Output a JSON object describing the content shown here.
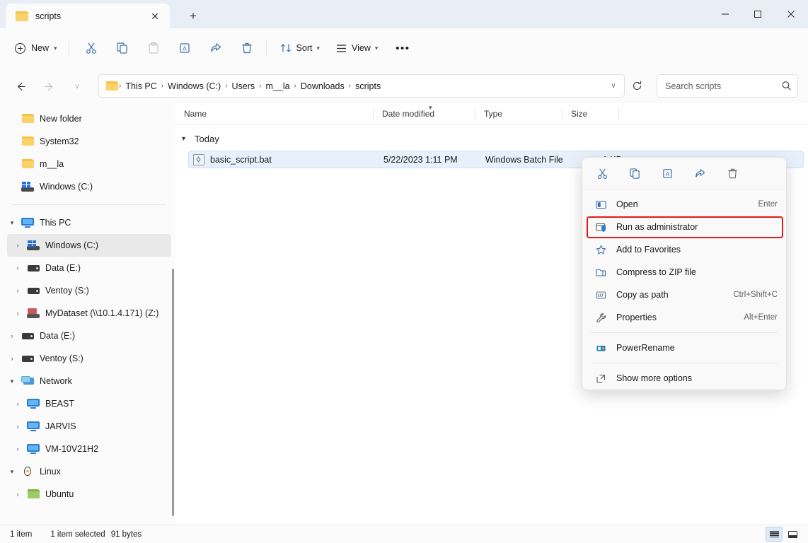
{
  "window": {
    "tab_title": "scripts",
    "controls": {
      "minimize": "—",
      "maximize": "☐",
      "close": "✕"
    },
    "new_tab_label": "+",
    "tab_close_label": "✕"
  },
  "toolbar": {
    "new_label": "New",
    "sort_label": "Sort",
    "view_label": "View",
    "more_label": "•••",
    "buttons": [
      "cut-icon",
      "copy-icon",
      "paste-icon",
      "rename-icon",
      "share-icon",
      "delete-icon"
    ]
  },
  "address": {
    "back": "←",
    "forward": "→",
    "recent": "∨",
    "up": "↑",
    "crumbs": [
      "This PC",
      "Windows (C:)",
      "Users",
      "m__la",
      "Downloads",
      "scripts"
    ],
    "separator": "›",
    "dropdown": "∨",
    "refresh": "⟳"
  },
  "search": {
    "placeholder": "Search scripts",
    "value": "",
    "icon": "search-icon"
  },
  "sidebar": {
    "quick_items": [
      {
        "label": "New folder",
        "icon": "folder-icon",
        "caret": "",
        "indent": 1
      },
      {
        "label": "System32",
        "icon": "folder-icon",
        "caret": "",
        "indent": 1
      },
      {
        "label": "m__la",
        "icon": "folder-icon",
        "caret": "",
        "indent": 1
      },
      {
        "label": "Windows (C:)",
        "icon": "windows-drive-icon",
        "caret": "",
        "indent": 1
      }
    ],
    "tree_items": [
      {
        "label": "This PC",
        "icon": "pc-icon",
        "caret": "⌄",
        "indent": 0,
        "selected": false
      },
      {
        "label": "Windows (C:)",
        "icon": "windows-drive-icon",
        "caret": "›",
        "indent": 1,
        "selected": true
      },
      {
        "label": "Data (E:)",
        "icon": "drive-icon",
        "caret": "›",
        "indent": 1,
        "selected": false
      },
      {
        "label": "Ventoy (S:)",
        "icon": "drive-icon",
        "caret": "›",
        "indent": 1,
        "selected": false
      },
      {
        "label": "MyDataset (\\\\10.1.4.171) (Z:)",
        "icon": "network-drive-icon",
        "caret": "›",
        "indent": 1,
        "selected": false
      },
      {
        "label": "Data (E:)",
        "icon": "drive-icon",
        "caret": "›",
        "indent": 0,
        "selected": false
      },
      {
        "label": "Ventoy (S:)",
        "icon": "drive-icon",
        "caret": "›",
        "indent": 0,
        "selected": false
      },
      {
        "label": "Network",
        "icon": "network-icon",
        "caret": "⌄",
        "indent": 0,
        "selected": false
      },
      {
        "label": "BEAST",
        "icon": "pc-icon",
        "caret": "›",
        "indent": 1,
        "selected": false
      },
      {
        "label": "JARVIS",
        "icon": "pc-icon",
        "caret": "›",
        "indent": 1,
        "selected": false
      },
      {
        "label": "VM-10V21H2",
        "icon": "pc-icon",
        "caret": "›",
        "indent": 1,
        "selected": false
      },
      {
        "label": "Linux",
        "icon": "linux-icon",
        "caret": "⌄",
        "indent": 0,
        "selected": false
      },
      {
        "label": "Ubuntu",
        "icon": "folder-green-icon",
        "caret": "›",
        "indent": 1,
        "selected": false
      }
    ]
  },
  "columns": [
    {
      "label": "Name",
      "key": "name"
    },
    {
      "label": "Date modified",
      "key": "date"
    },
    {
      "label": "Type",
      "key": "type"
    },
    {
      "label": "Size",
      "key": "size"
    }
  ],
  "group": {
    "caret": "⌄",
    "label": "Today"
  },
  "files": [
    {
      "name": "basic_script.bat",
      "date": "5/22/2023 1:11 PM",
      "type": "Windows Batch File",
      "size": "1 KB",
      "icon": "bat-file-icon",
      "selected": true
    }
  ],
  "context_menu": {
    "icon_row": [
      {
        "name": "cut-icon",
        "glyph": "✂"
      },
      {
        "name": "copy-icon",
        "glyph": "⧉"
      },
      {
        "name": "rename-icon",
        "glyph": "A"
      },
      {
        "name": "share-icon",
        "glyph": "↪"
      },
      {
        "name": "delete-icon",
        "glyph": "🗑"
      }
    ],
    "items": [
      {
        "label": "Open",
        "accel": "Enter",
        "icon": "open-icon",
        "highlighted": false,
        "sep_after": false
      },
      {
        "label": "Run as administrator",
        "accel": "",
        "icon": "shield-icon",
        "highlighted": true,
        "sep_after": false
      },
      {
        "label": "Add to Favorites",
        "accel": "",
        "icon": "star-icon",
        "highlighted": false,
        "sep_after": false
      },
      {
        "label": "Compress to ZIP file",
        "accel": "",
        "icon": "zip-icon",
        "highlighted": false,
        "sep_after": false
      },
      {
        "label": "Copy as path",
        "accel": "Ctrl+Shift+C",
        "icon": "copy-path-icon",
        "highlighted": false,
        "sep_after": false
      },
      {
        "label": "Properties",
        "accel": "Alt+Enter",
        "icon": "wrench-icon",
        "highlighted": false,
        "sep_after": true
      },
      {
        "label": "PowerRename",
        "accel": "",
        "icon": "powerrename-icon",
        "highlighted": false,
        "sep_after": true
      },
      {
        "label": "Show more options",
        "accel": "",
        "icon": "more-options-icon",
        "highlighted": false,
        "sep_after": false
      }
    ],
    "highlight_color": "#e01b1b"
  },
  "status": {
    "item_count": "1 item",
    "selected_count": "1 item selected",
    "selected_size": "91 bytes",
    "view_details": "details-view-icon",
    "view_large": "large-icons-view-icon"
  }
}
